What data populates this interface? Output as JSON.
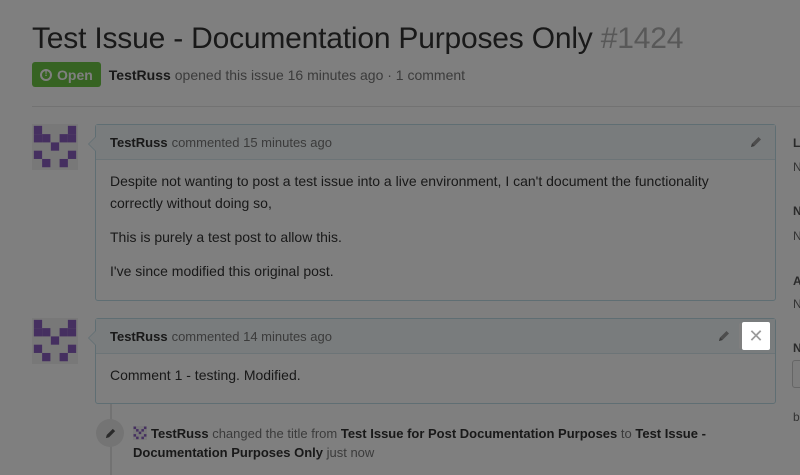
{
  "issue": {
    "title": "Test Issue - Documentation Purposes Only",
    "number": "#1424",
    "state": "Open",
    "author": "TestRuss",
    "opened_text": "opened this issue 16 minutes ago · 1 comment"
  },
  "comments": [
    {
      "author": "TestRuss",
      "time_text": "commented 15 minutes ago",
      "paragraphs": [
        "Despite not wanting to post a test issue into a live environment, I can't document the functionality correctly without doing so,",
        "This is purely a test post to allow this.",
        "I've since modified this original post."
      ]
    },
    {
      "author": "TestRuss",
      "time_text": "commented 14 minutes ago",
      "paragraphs": [
        "Comment 1 - testing. Modified."
      ]
    }
  ],
  "event": {
    "actor": "TestRuss",
    "action": "changed the title from",
    "old_title": "Test Issue for Post Documentation Purposes",
    "to_word": "to",
    "new_title": "Test Issue - Documentation Purposes Only",
    "time": "just now"
  },
  "sidebar_fragments": [
    "L",
    "N",
    "N",
    "N",
    "A",
    "N",
    "N",
    "b"
  ],
  "icons": {
    "edit": "pencil-icon",
    "close": "close-icon",
    "state": "issue-opened-icon",
    "event": "pencil-icon"
  },
  "colors": {
    "open_badge": "#6cc644",
    "avatar": "#8a5fc0",
    "comment_border": "#bfdce6"
  }
}
